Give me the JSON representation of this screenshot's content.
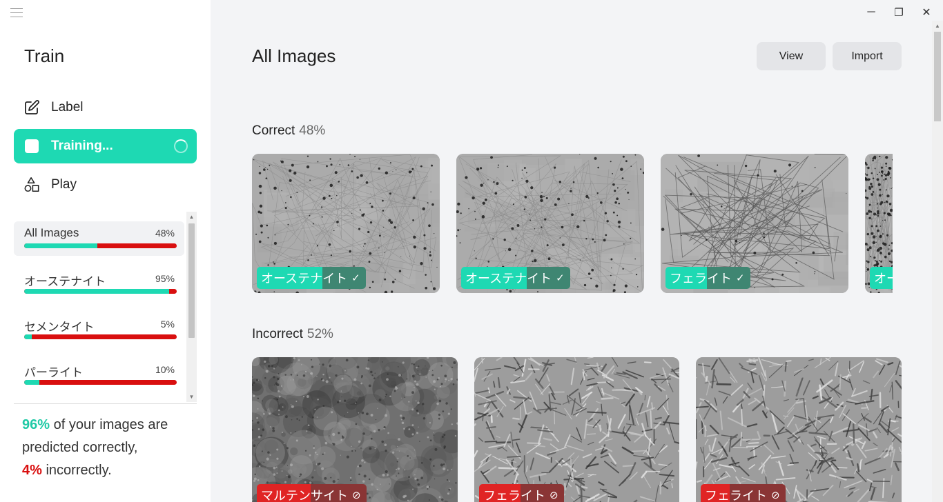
{
  "sidebar": {
    "title": "Train",
    "nav": [
      {
        "label": "Label",
        "icon": "pencil-square-icon"
      },
      {
        "label": "Training...",
        "icon": "training-square-icon",
        "active": true
      },
      {
        "label": "Play",
        "icon": "shapes-icon"
      }
    ],
    "categories": [
      {
        "name": "All Images",
        "percent_label": "48%",
        "correct_fraction": 0.48,
        "selected": true
      },
      {
        "name": "オーステナイト",
        "percent_label": "95%",
        "correct_fraction": 0.95
      },
      {
        "name": "セメンタイト",
        "percent_label": "5%",
        "correct_fraction": 0.05
      },
      {
        "name": "パーライト",
        "percent_label": "10%",
        "correct_fraction": 0.1
      }
    ],
    "summary": {
      "good_pct": "96%",
      "good_text": " of your images are predicted correctly,",
      "bad_pct": "4%",
      "bad_text": " incorrectly."
    }
  },
  "main": {
    "title": "All Images",
    "buttons": {
      "view": "View",
      "import": "Import"
    },
    "correct": {
      "label": "Correct",
      "percent": "48%",
      "images": [
        {
          "tag_a": "オーステナ",
          "tag_b": "イト",
          "status_icon": "✓"
        },
        {
          "tag_a": "オーステナ",
          "tag_b": "イト",
          "status_icon": "✓"
        },
        {
          "tag_a": "フェラ",
          "tag_b": "イト",
          "status_icon": "✓"
        },
        {
          "tag_a": "オー",
          "tag_b": "",
          "status_icon": ""
        }
      ]
    },
    "incorrect": {
      "label": "Incorrect",
      "percent": "52%",
      "images": [
        {
          "tag_a": "マルテン",
          "tag_b": "サイト",
          "status_icon": "⊘"
        },
        {
          "tag_a": "フェラ",
          "tag_b": "イト",
          "status_icon": "⊘"
        },
        {
          "tag_a": "フェ",
          "tag_b": "ライト",
          "status_icon": "⊘"
        }
      ]
    }
  },
  "window": {
    "minimize": "─",
    "restore": "❐",
    "close": "✕"
  },
  "colors": {
    "accent": "#1ed9b3",
    "error": "#d90f0f"
  }
}
